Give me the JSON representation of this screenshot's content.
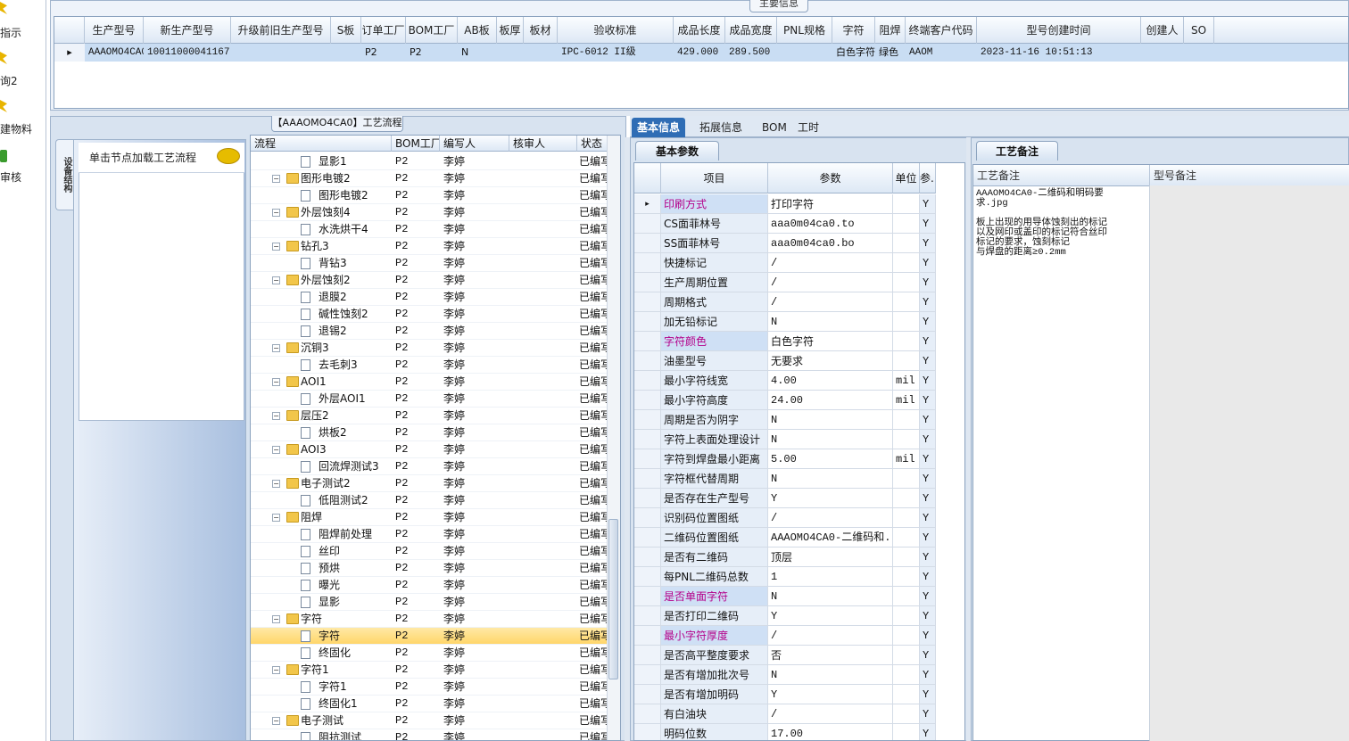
{
  "nav": {
    "items": [
      "指示",
      "询2",
      "建物料",
      "审核"
    ]
  },
  "main_info": {
    "tab_label": "主要信息",
    "columns": [
      "生产型号",
      "新生产型号",
      "升级前旧生产型号",
      "S板",
      "订单工厂",
      "BOM工厂",
      "AB板",
      "板厚",
      "板材",
      "验收标准",
      "成品长度",
      "成品宽度",
      "PNL规格",
      "字符",
      "阻焊",
      "终端客户代码",
      "型号创建时间",
      "创建人",
      "SO"
    ],
    "row": [
      "AAAOMO4CA0",
      "10011000041167",
      "",
      "",
      "P2",
      "P2",
      "N",
      "",
      "",
      "IPC-6012 II级",
      "429.000",
      "289.500",
      "",
      "白色字符",
      "绿色",
      "AAOM",
      "2023-11-16 10:51:13",
      "",
      ""
    ]
  },
  "flow": {
    "title": "【AAAOMO4CA0】工艺流程",
    "side_tab": "设备结构",
    "hint": "单击节点加载工艺流程",
    "columns": [
      "流程",
      "BOM工厂",
      "编写人",
      "核审人",
      "状态"
    ],
    "rows": [
      {
        "name": "显影1",
        "level": 2,
        "bom": "P2",
        "author": "李婷",
        "reviewer": "",
        "status": "已编写"
      },
      {
        "name": "图形电镀2",
        "level": 1,
        "bom": "P2",
        "author": "李婷",
        "reviewer": "",
        "status": "已编写"
      },
      {
        "name": "图形电镀2",
        "level": 2,
        "bom": "P2",
        "author": "李婷",
        "reviewer": "",
        "status": "已编写"
      },
      {
        "name": "外层蚀刻4",
        "level": 1,
        "bom": "P2",
        "author": "李婷",
        "reviewer": "",
        "status": "已编写"
      },
      {
        "name": "水洗烘干4",
        "level": 2,
        "bom": "P2",
        "author": "李婷",
        "reviewer": "",
        "status": "已编写"
      },
      {
        "name": "钻孔3",
        "level": 1,
        "bom": "P2",
        "author": "李婷",
        "reviewer": "",
        "status": "已编写"
      },
      {
        "name": "背钻3",
        "level": 2,
        "bom": "P2",
        "author": "李婷",
        "reviewer": "",
        "status": "已编写"
      },
      {
        "name": "外层蚀刻2",
        "level": 1,
        "bom": "P2",
        "author": "李婷",
        "reviewer": "",
        "status": "已编写"
      },
      {
        "name": "退膜2",
        "level": 2,
        "bom": "P2",
        "author": "李婷",
        "reviewer": "",
        "status": "已编写"
      },
      {
        "name": "碱性蚀刻2",
        "level": 2,
        "bom": "P2",
        "author": "李婷",
        "reviewer": "",
        "status": "已编写"
      },
      {
        "name": "退锡2",
        "level": 2,
        "bom": "P2",
        "author": "李婷",
        "reviewer": "",
        "status": "已编写"
      },
      {
        "name": "沉铜3",
        "level": 1,
        "bom": "P2",
        "author": "李婷",
        "reviewer": "",
        "status": "已编写"
      },
      {
        "name": "去毛刺3",
        "level": 2,
        "bom": "P2",
        "author": "李婷",
        "reviewer": "",
        "status": "已编写"
      },
      {
        "name": "AOI1",
        "level": 1,
        "bom": "P2",
        "author": "李婷",
        "reviewer": "",
        "status": "已编写"
      },
      {
        "name": "外层AOI1",
        "level": 2,
        "bom": "P2",
        "author": "李婷",
        "reviewer": "",
        "status": "已编写"
      },
      {
        "name": "层压2",
        "level": 1,
        "bom": "P2",
        "author": "李婷",
        "reviewer": "",
        "status": "已编写"
      },
      {
        "name": "烘板2",
        "level": 2,
        "bom": "P2",
        "author": "李婷",
        "reviewer": "",
        "status": "已编写"
      },
      {
        "name": "AOI3",
        "level": 1,
        "bom": "P2",
        "author": "李婷",
        "reviewer": "",
        "status": "已编写"
      },
      {
        "name": "回流焊测试3",
        "level": 2,
        "bom": "P2",
        "author": "李婷",
        "reviewer": "",
        "status": "已编写"
      },
      {
        "name": "电子测试2",
        "level": 1,
        "bom": "P2",
        "author": "李婷",
        "reviewer": "",
        "status": "已编写"
      },
      {
        "name": "低阻测试2",
        "level": 2,
        "bom": "P2",
        "author": "李婷",
        "reviewer": "",
        "status": "已编写"
      },
      {
        "name": "阻焊",
        "level": 1,
        "bom": "P2",
        "author": "李婷",
        "reviewer": "",
        "status": "已编写"
      },
      {
        "name": "阻焊前处理",
        "level": 2,
        "bom": "P2",
        "author": "李婷",
        "reviewer": "",
        "status": "已编写"
      },
      {
        "name": "丝印",
        "level": 2,
        "bom": "P2",
        "author": "李婷",
        "reviewer": "",
        "status": "已编写"
      },
      {
        "name": "预烘",
        "level": 2,
        "bom": "P2",
        "author": "李婷",
        "reviewer": "",
        "status": "已编写"
      },
      {
        "name": "曝光",
        "level": 2,
        "bom": "P2",
        "author": "李婷",
        "reviewer": "",
        "status": "已编写"
      },
      {
        "name": "显影",
        "level": 2,
        "bom": "P2",
        "author": "李婷",
        "reviewer": "",
        "status": "已编写"
      },
      {
        "name": "字符",
        "level": 1,
        "bom": "P2",
        "author": "李婷",
        "reviewer": "",
        "status": "已编写"
      },
      {
        "name": "字符",
        "level": 2,
        "bom": "P2",
        "author": "李婷",
        "reviewer": "",
        "status": "已编写",
        "selected": true
      },
      {
        "name": "终固化",
        "level": 2,
        "bom": "P2",
        "author": "李婷",
        "reviewer": "",
        "status": "已编写"
      },
      {
        "name": "字符1",
        "level": 1,
        "bom": "P2",
        "author": "李婷",
        "reviewer": "",
        "status": "已编写"
      },
      {
        "name": "字符1",
        "level": 2,
        "bom": "P2",
        "author": "李婷",
        "reviewer": "",
        "status": "已编写"
      },
      {
        "name": "终固化1",
        "level": 2,
        "bom": "P2",
        "author": "李婷",
        "reviewer": "",
        "status": "已编写"
      },
      {
        "name": "电子测试",
        "level": 1,
        "bom": "P2",
        "author": "李婷",
        "reviewer": "",
        "status": "已编写"
      },
      {
        "name": "阻抗测试",
        "level": 2,
        "bom": "P2",
        "author": "李婷",
        "reviewer": "",
        "status": "已编写"
      }
    ]
  },
  "right_tabs": [
    "基本信息",
    "拓展信息",
    "BOM",
    "工时"
  ],
  "params": {
    "tab_label": "基本参数",
    "columns": [
      "项目",
      "参数",
      "单位",
      "参..."
    ],
    "rows": [
      {
        "item": "印刷方式",
        "value": "打印字符",
        "unit": "",
        "flag": "Y",
        "highlight": true
      },
      {
        "item": "CS面菲林号",
        "value": "aaa0m04ca0.to",
        "unit": "",
        "flag": "Y"
      },
      {
        "item": "SS面菲林号",
        "value": "aaa0m04ca0.bo",
        "unit": "",
        "flag": "Y"
      },
      {
        "item": "快捷标记",
        "value": "/",
        "unit": "",
        "flag": "Y"
      },
      {
        "item": "生产周期位置",
        "value": "/",
        "unit": "",
        "flag": "Y"
      },
      {
        "item": "周期格式",
        "value": "/",
        "unit": "",
        "flag": "Y"
      },
      {
        "item": "加无铅标记",
        "value": "N",
        "unit": "",
        "flag": "Y"
      },
      {
        "item": "字符颜色",
        "value": "白色字符",
        "unit": "",
        "flag": "Y",
        "highlight": true
      },
      {
        "item": "油墨型号",
        "value": "无要求",
        "unit": "",
        "flag": "Y"
      },
      {
        "item": "最小字符线宽",
        "value": "4.00",
        "unit": "mil",
        "flag": "Y"
      },
      {
        "item": "最小字符高度",
        "value": "24.00",
        "unit": "mil",
        "flag": "Y"
      },
      {
        "item": "周期是否为阴字",
        "value": "N",
        "unit": "",
        "flag": "Y"
      },
      {
        "item": "字符上表面处理设计",
        "value": "N",
        "unit": "",
        "flag": "Y"
      },
      {
        "item": "字符到焊盘最小距离",
        "value": "5.00",
        "unit": "mil",
        "flag": "Y"
      },
      {
        "item": "字符框代替周期",
        "value": "N",
        "unit": "",
        "flag": "Y"
      },
      {
        "item": "是否存在生产型号",
        "value": "Y",
        "unit": "",
        "flag": "Y"
      },
      {
        "item": "识别码位置图纸",
        "value": "/",
        "unit": "",
        "flag": "Y"
      },
      {
        "item": "二维码位置图纸",
        "value": "AAAOMO4CA0-二维码和...",
        "unit": "",
        "flag": "Y"
      },
      {
        "item": "是否有二维码",
        "value": "顶层",
        "unit": "",
        "flag": "Y"
      },
      {
        "item": "每PNL二维码总数",
        "value": "1",
        "unit": "",
        "flag": "Y"
      },
      {
        "item": "是否单面字符",
        "value": "N",
        "unit": "",
        "flag": "Y",
        "highlight": true
      },
      {
        "item": "是否打印二维码",
        "value": "Y",
        "unit": "",
        "flag": "Y"
      },
      {
        "item": "最小字符厚度",
        "value": "/",
        "unit": "",
        "flag": "Y",
        "highlight": true
      },
      {
        "item": "是否高平整度要求",
        "value": "否",
        "unit": "",
        "flag": "Y"
      },
      {
        "item": "是否有增加批次号",
        "value": "N",
        "unit": "",
        "flag": "Y"
      },
      {
        "item": "是否有增加明码",
        "value": "Y",
        "unit": "",
        "flag": "Y"
      },
      {
        "item": "有白油块",
        "value": "/",
        "unit": "",
        "flag": "Y"
      },
      {
        "item": "明码位数",
        "value": "17.00",
        "unit": "",
        "flag": "Y"
      }
    ]
  },
  "remarks": {
    "tab_label": "工艺备注",
    "col1": "工艺备注",
    "col2": "型号备注",
    "text": "AAAOMO4CA0-二维码和明码要\n求.jpg\n\n板上出现的用导体蚀刻出的标记\n以及网印或盖印的标记符合丝印\n标记的要求，蚀刻标记\n与焊盘的距离≥0.2mm"
  },
  "colors": {
    "highlight_text": "#b4008a",
    "selection": "#ffd66a",
    "accent": "#2f6db5"
  }
}
